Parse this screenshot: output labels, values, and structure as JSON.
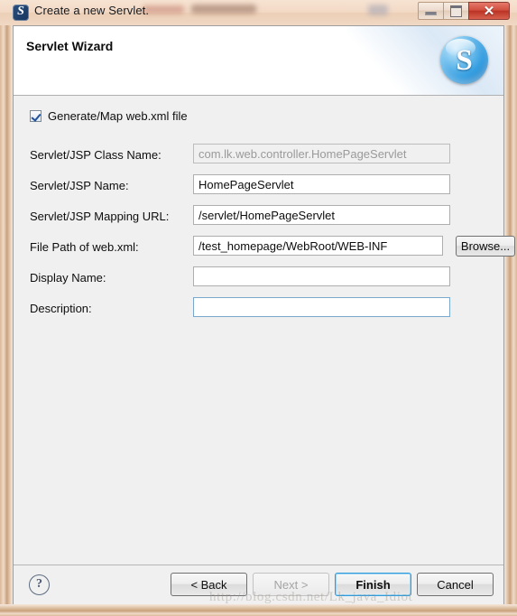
{
  "window": {
    "title": "Create a new Servlet.",
    "icon": "servlet-app-icon",
    "icon_glyph": "S",
    "controls": {
      "minimize": "minimize-icon",
      "maximize": "maximize-icon",
      "close": "✕"
    }
  },
  "banner": {
    "title": "Servlet Wizard",
    "logo_glyph": "S",
    "logo_name": "servlet-sphere-logo"
  },
  "content": {
    "checkbox": {
      "label": "Generate/Map web.xml file",
      "checked": true
    },
    "fields": [
      {
        "label": "Servlet/JSP Class Name:",
        "value": "com.lk.web.controller.HomePageServlet",
        "placeholder": "",
        "disabled": true,
        "focused": false
      },
      {
        "label": "Servlet/JSP Name:",
        "value": "HomePageServlet",
        "placeholder": "",
        "disabled": false,
        "focused": false
      },
      {
        "label": "Servlet/JSP Mapping URL:",
        "value": "/servlet/HomePageServlet",
        "placeholder": "",
        "disabled": false,
        "focused": false
      },
      {
        "label": "File Path of web.xml:",
        "value": "/test_homepage/WebRoot/WEB-INF",
        "placeholder": "",
        "disabled": false,
        "focused": false
      },
      {
        "label": "Display Name:",
        "value": "",
        "placeholder": "",
        "disabled": false,
        "focused": false
      },
      {
        "label": "Description:",
        "value": "",
        "placeholder": "",
        "disabled": false,
        "focused": true
      }
    ],
    "browse_button": "Browse..."
  },
  "buttonbar": {
    "help": "?",
    "buttons": [
      {
        "label": "< Back",
        "disabled": false,
        "default": false
      },
      {
        "label": "Next >",
        "disabled": true,
        "default": false
      },
      {
        "label": "Finish",
        "disabled": false,
        "default": true
      },
      {
        "label": "Cancel",
        "disabled": false,
        "default": false
      }
    ]
  },
  "watermark": "http://blog.csdn.net/Lk_java_Idiot",
  "colors": {
    "frame": "#d9b795",
    "dialog_bg": "#f0f0f0",
    "banner_bg": "#ffffff",
    "accent_blue": "#2f9bda",
    "close_red": "#bb3325",
    "disabled_text": "#9a9a9a"
  }
}
